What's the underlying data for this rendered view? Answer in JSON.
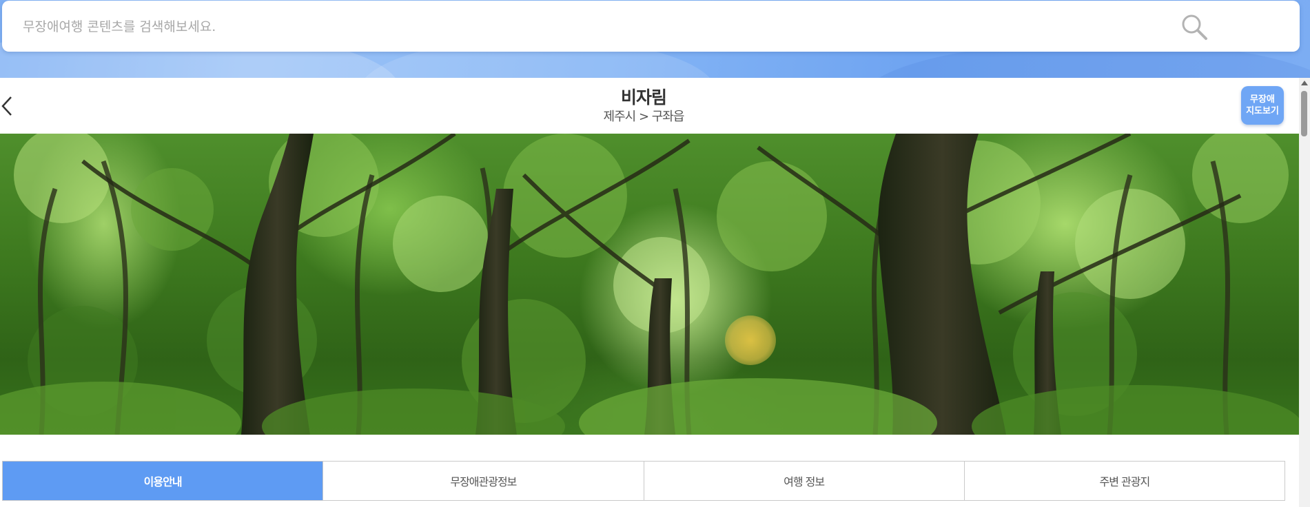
{
  "search": {
    "placeholder": "무장애여행 콘텐츠를 검색해보세요.",
    "value": ""
  },
  "header": {
    "title": "비자림",
    "breadcrumb": "제주시 > 구좌읍",
    "map_button_line1": "무장애",
    "map_button_line2": "지도보기"
  },
  "tabs": [
    {
      "label": "이용안내",
      "active": true
    },
    {
      "label": "무장애관광정보",
      "active": false
    },
    {
      "label": "여행 정보",
      "active": false
    },
    {
      "label": "주변 관광지",
      "active": false
    }
  ],
  "icons": {
    "search": "search-icon",
    "back": "chevron-left-icon"
  },
  "colors": {
    "accent": "#5e9bf3",
    "search_band": "#7fb0f4",
    "map_button": "#6fa6f5"
  }
}
